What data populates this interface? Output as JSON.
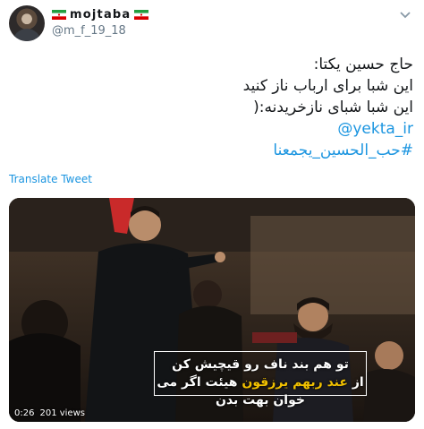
{
  "user": {
    "display_name": "mojtaba",
    "handle": "@m_f_19_18",
    "avatar_icon": "user-avatar",
    "flag_icon": "iran-flag-icon"
  },
  "menu_icon": "chevron-down-icon",
  "tweet": {
    "lines": [
      "حاج حسین یکتا:",
      "این شبا برای ارباب ناز کنید",
      "این شبا شبای نازخریدنه:("
    ],
    "mention": "@yekta_ir",
    "hashtag": "#حب_الحسین_یجمعنا"
  },
  "translate_label": "Translate Tweet",
  "video": {
    "caption_line1": "تو هم بند ناف رو قیچیش کن",
    "caption_line2_prefix": "از ",
    "caption_line2_highlight": "عند ربهم یرزقون",
    "caption_line2_suffix": " هیئت اگر می خوان بهت بدن",
    "time": "0:26",
    "views": "201 views",
    "highlight_color": "#f0c000"
  },
  "colors": {
    "link": "#1b95e0",
    "secondary": "#657786"
  }
}
